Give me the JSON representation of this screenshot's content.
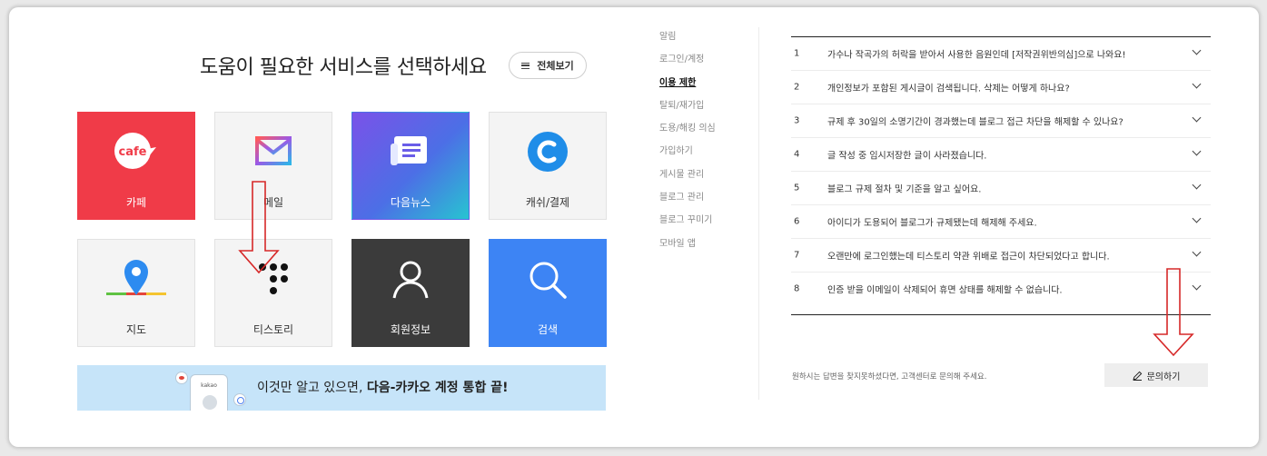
{
  "header": {
    "title": "도움이 필요한 서비스를 선택하세요",
    "view_all_label": "전체보기"
  },
  "services": [
    {
      "label": "카페",
      "icon": "cafe-icon",
      "icon_text": "cafe"
    },
    {
      "label": "메일",
      "icon": "mail-icon"
    },
    {
      "label": "다음뉴스",
      "icon": "news-icon"
    },
    {
      "label": "캐쉬/결제",
      "icon": "cash-icon"
    },
    {
      "label": "지도",
      "icon": "map-pin-icon"
    },
    {
      "label": "티스토리",
      "icon": "tistory-icon"
    },
    {
      "label": "회원정보",
      "icon": "user-icon"
    },
    {
      "label": "검색",
      "icon": "search-icon"
    }
  ],
  "banner": {
    "phone_label": "kakao",
    "text_plain": "이것만 알고 있으면, ",
    "text_bold": "다음-카카오 계정 통합 끝!"
  },
  "menu": {
    "active_index": 2,
    "items": [
      "알림",
      "로그인/계정",
      "이용 제한",
      "탈퇴/재가입",
      "도용/해킹 의심",
      "가입하기",
      "게시물 관리",
      "블로그 관리",
      "블로그 꾸미기",
      "모바일 앱"
    ]
  },
  "faq": [
    {
      "num": "1",
      "question": "가수나 작곡가의 허락을 받아서 사용한 음원인데 [저작권위반의심]으로 나와요!"
    },
    {
      "num": "2",
      "question": "개인정보가 포함된 게시글이 검색됩니다. 삭제는 어떻게 하나요?"
    },
    {
      "num": "3",
      "question": "규제 후 30일의 소명기간이 경과했는데 블로그 접근 차단을 해제할 수 있나요?"
    },
    {
      "num": "4",
      "question": "글 작성 중 임시저장한 글이 사라졌습니다."
    },
    {
      "num": "5",
      "question": "블로그 규제 절차 및 기준을 알고 싶어요."
    },
    {
      "num": "6",
      "question": "아이디가 도용되어 블로그가 규제됐는데 해제해 주세요."
    },
    {
      "num": "7",
      "question": "오랜만에 로그인했는데 티스토리 약관 위배로 접근이 차단되었다고 합니다."
    },
    {
      "num": "8",
      "question": "인증 받을 이메일이 삭제되어 휴면 상태를 해제할 수 없습니다."
    }
  ],
  "footer": {
    "notice": "원하시는 답변을 찾지못하셨다면, 고객센터로 문의해 주세요.",
    "inquiry_label": "문의하기"
  },
  "colors": {
    "cafe": "#f03b48",
    "member": "#3b3b3b",
    "search": "#3d84f4",
    "cash": "#1f8de8",
    "annotation_arrow": "#d62828"
  }
}
